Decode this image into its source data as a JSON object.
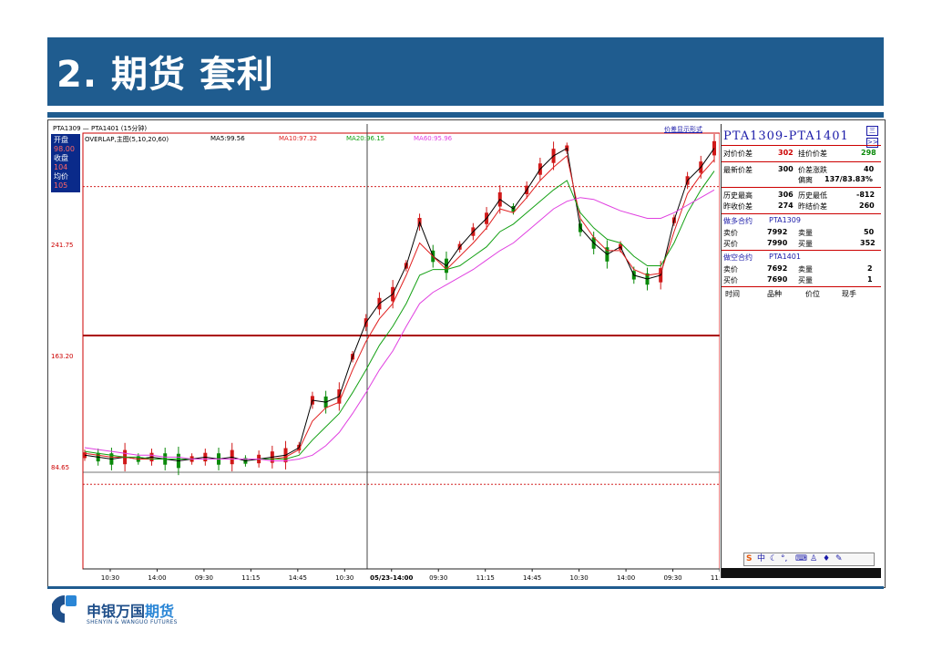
{
  "slide": {
    "title": "2. 期货 套利"
  },
  "chart_header": {
    "pair_label": "PTA1309 — PTA1401 (15分钟)",
    "overlay_label": "OVERLAP,主图(5,10,20,60)",
    "ma5": "MA5:99.56",
    "ma10": "MA10:97.32",
    "ma20": "MA20:96.15",
    "ma60": "MA60:95.96",
    "display_mode_link": "价差显示形式"
  },
  "side_buttons": {
    "open_label": "开盘",
    "open_val": "98.00",
    "close_label": "收盘",
    "close_val": "104",
    "avg_label": "均价",
    "avg_val": "105"
  },
  "price_levels": {
    "high": "241.75",
    "mid": "163.20",
    "low": "84.65"
  },
  "x_ticks": [
    "10:30",
    "14:00",
    "09:30",
    "11:15",
    "14:45",
    "10:30",
    "05/23-14:00",
    "09:30",
    "11:15",
    "14:45",
    "10:30",
    "14:00",
    "09:30",
    "11:15"
  ],
  "colors": {
    "ma5": "#000000",
    "ma10": "#e02020",
    "ma20": "#13a013",
    "ma60": "#e040e0",
    "accent": "#1f5c8f",
    "candle_up": "#d01818",
    "candle_down": "#0a8a0a"
  },
  "chart_data": {
    "type": "line",
    "ylim": [
      40,
      270
    ],
    "series": [
      {
        "name": "MA5",
        "values": [
          100,
          99,
          98,
          99,
          98,
          99,
          98,
          97,
          98,
          99,
          98,
          99,
          97,
          98,
          99,
          100,
          104,
          129,
          128,
          131,
          152,
          170,
          180,
          185,
          200,
          223,
          205,
          200,
          210,
          218,
          225,
          235,
          230,
          240,
          251,
          258,
          262,
          220,
          212,
          206,
          210,
          195,
          193,
          195,
          224,
          245,
          252,
          262
        ]
      },
      {
        "name": "MA10",
        "values": [
          101,
          100,
          99,
          99,
          98,
          98,
          98,
          98,
          98,
          98,
          98,
          98,
          98,
          98,
          98,
          99,
          103,
          118,
          125,
          128,
          145,
          160,
          172,
          180,
          195,
          212,
          205,
          198,
          205,
          212,
          220,
          230,
          228,
          236,
          245,
          252,
          258,
          225,
          215,
          208,
          208,
          198,
          195,
          196,
          218,
          238,
          248,
          256
        ]
      },
      {
        "name": "MA20",
        "values": [
          102,
          101,
          100,
          99,
          99,
          98,
          98,
          98,
          98,
          98,
          98,
          98,
          98,
          98,
          98,
          98,
          100,
          108,
          115,
          122,
          133,
          145,
          158,
          168,
          180,
          195,
          198,
          198,
          200,
          205,
          210,
          218,
          222,
          228,
          234,
          240,
          245,
          228,
          220,
          214,
          212,
          205,
          200,
          200,
          212,
          228,
          240,
          250
        ]
      },
      {
        "name": "MA60",
        "values": [
          104,
          103,
          102,
          101,
          100,
          100,
          99,
          99,
          98,
          98,
          98,
          98,
          98,
          98,
          97,
          97,
          98,
          100,
          105,
          112,
          122,
          133,
          145,
          155,
          168,
          180,
          186,
          190,
          194,
          198,
          203,
          208,
          212,
          218,
          224,
          230,
          234,
          236,
          235,
          232,
          229,
          227,
          225,
          225,
          228,
          232,
          236,
          240
        ]
      }
    ]
  },
  "panel": {
    "title": "PTA1309-PTA1401",
    "btn_top": "三",
    "btn_next": ">>",
    "r1": {
      "l1": "对价价差",
      "v1": "302",
      "l2": "挂价价差",
      "v2": "298"
    },
    "r2": {
      "l1": "最新价差",
      "v1": "300",
      "l2": "价差涨跌",
      "v2": "40"
    },
    "r3": {
      "l2": "偏离",
      "v2": "137/83.83%"
    },
    "r4": {
      "l1": "历史最高",
      "v1": "306",
      "l2": "历史最低",
      "v2": "-812"
    },
    "r5": {
      "l1": "昨收价差",
      "v1": "274",
      "l2": "昨结价差",
      "v2": "260"
    },
    "long_leg": {
      "label": "做多合约",
      "code": "PTA1309"
    },
    "r6": {
      "l1": "卖价",
      "v1": "7992",
      "l2": "卖量",
      "v2": "50"
    },
    "r7": {
      "l1": "买价",
      "v1": "7990",
      "l2": "买量",
      "v2": "352"
    },
    "short_leg": {
      "label": "做空合约",
      "code": "PTA1401"
    },
    "r8": {
      "l1": "卖价",
      "v1": "7692",
      "l2": "卖量",
      "v2": "2"
    },
    "r9": {
      "l1": "买价",
      "v1": "7690",
      "l2": "买量",
      "v2": "1"
    },
    "cols": {
      "c1": "时间",
      "c2": "品种",
      "c3": "价位",
      "c4": "现手"
    },
    "toolbar": {
      "s": "S",
      "zh": "中"
    }
  },
  "logo": {
    "cn_main": "申银万国",
    "cn_accent": "期货",
    "en": "SHENYIN & WANGUO FUTURES"
  }
}
